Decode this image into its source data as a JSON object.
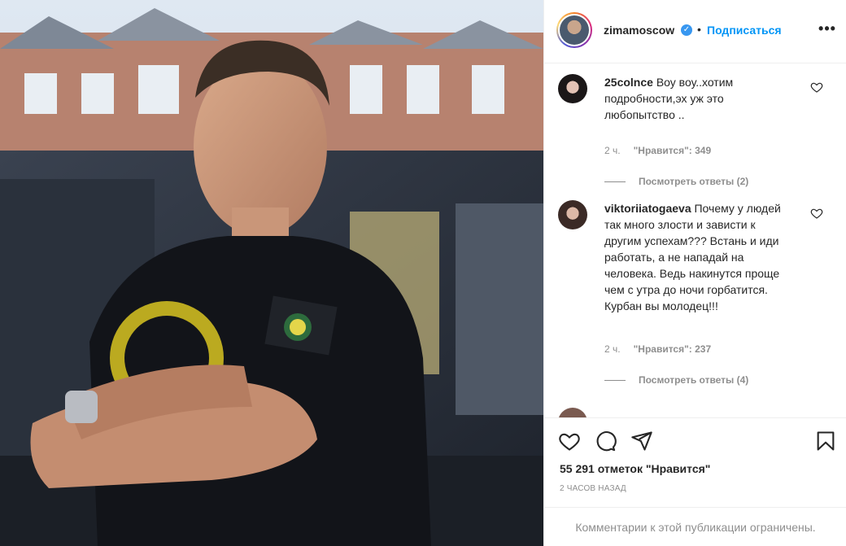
{
  "post": {
    "username": "zimamoscow",
    "follow_label": "Подписаться",
    "separator": "•",
    "more_label": "•••",
    "verified_mark": "✓"
  },
  "comments": [
    {
      "username": "25colnce",
      "text": " Воу воу..хотим подробности,эх уж это любопытство ..",
      "time": "2 ч.",
      "likes": "\"Нравится\": 349",
      "replies": "Посмотреть ответы (2)"
    },
    {
      "username": "viktoriiatogaeva",
      "text": " Почему у людей так много злости и зависти к другим успехам??? Встань и иди работать, а не нападай на человека. Ведь накинутся проще чем с утра до ночи горбатится. Курбан вы молодец!!!",
      "time": "2 ч.",
      "likes": "\"Нравится\": 237",
      "replies": "Посмотреть ответы (4)"
    }
  ],
  "actions": {
    "like_count": "55 291 отметок \"Нравится\"",
    "time": "2 ЧАСОВ НАЗАД",
    "comments_limited": "Комментарии к этой публикации ограничены."
  },
  "icons": {
    "like": "heart-icon",
    "comment": "comment-icon",
    "share": "share-icon",
    "save": "bookmark-icon",
    "more": "more-icon"
  },
  "colors": {
    "link": "#0095f6",
    "verified": "#3897f0",
    "muted": "#8e8e8e",
    "text": "#262626"
  }
}
